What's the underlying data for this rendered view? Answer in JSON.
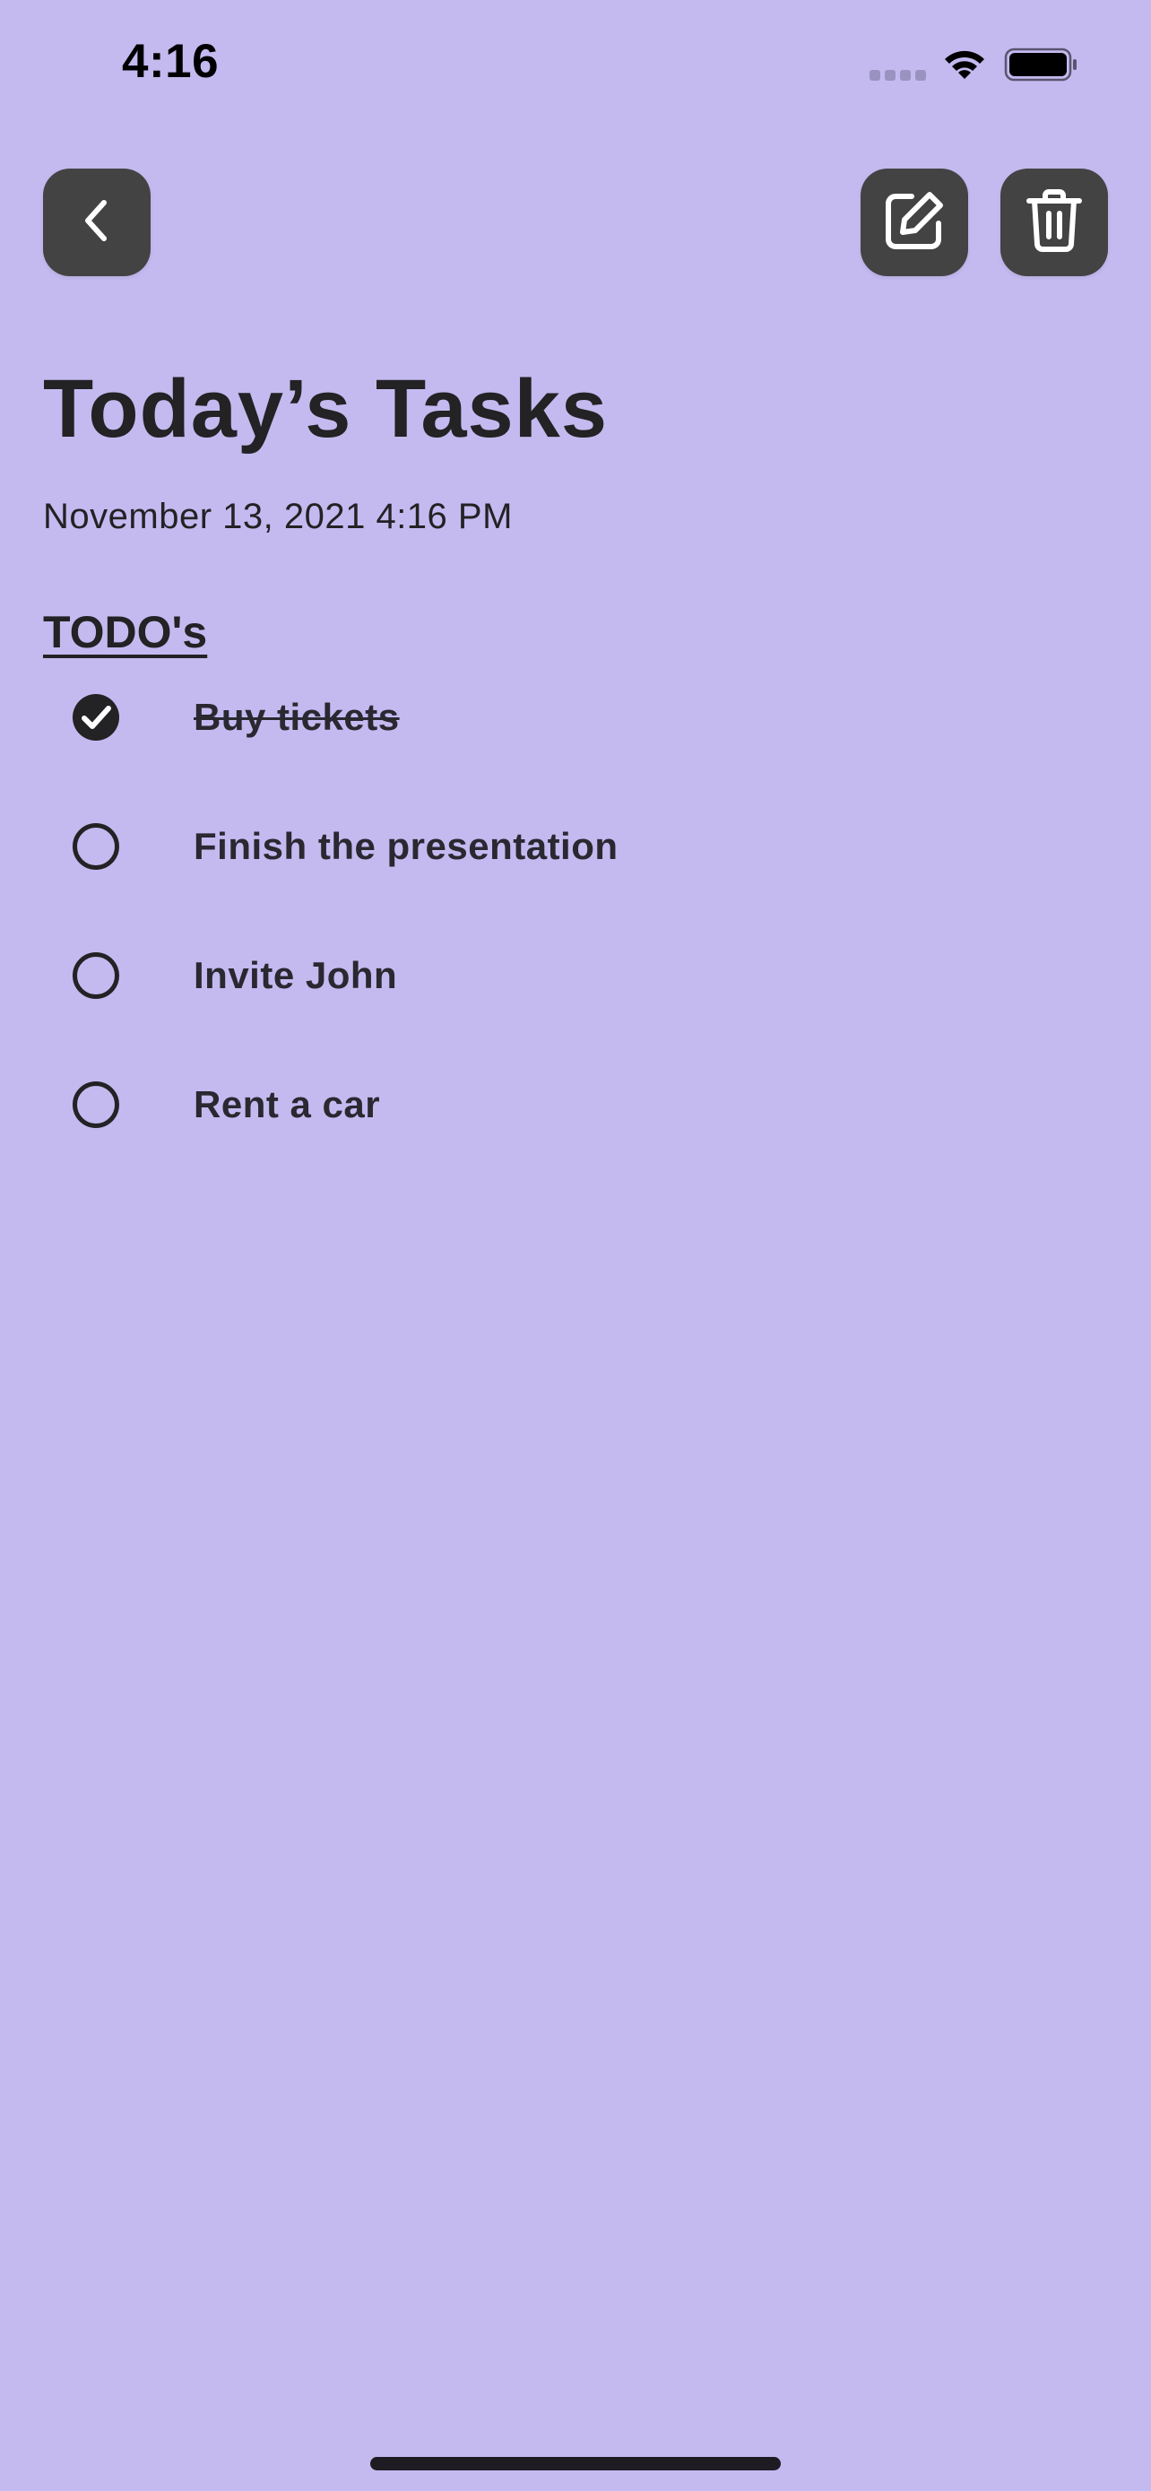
{
  "status_bar": {
    "time": "4:16"
  },
  "toolbar": {
    "back_icon": "chevron-left-icon",
    "edit_icon": "pencil-square-icon",
    "delete_icon": "trash-icon"
  },
  "note": {
    "title": "Today’s Tasks",
    "datetime": "November 13, 2021  4:16 PM",
    "section_title": "TODO's"
  },
  "todos": [
    {
      "label": "Buy tickets",
      "done": true
    },
    {
      "label": "Finish the presentation",
      "done": false
    },
    {
      "label": "Invite John",
      "done": false
    },
    {
      "label": "Rent a car",
      "done": false
    }
  ],
  "colors": {
    "background": "#C4BAF0",
    "button": "#434343",
    "text": "#232224"
  }
}
